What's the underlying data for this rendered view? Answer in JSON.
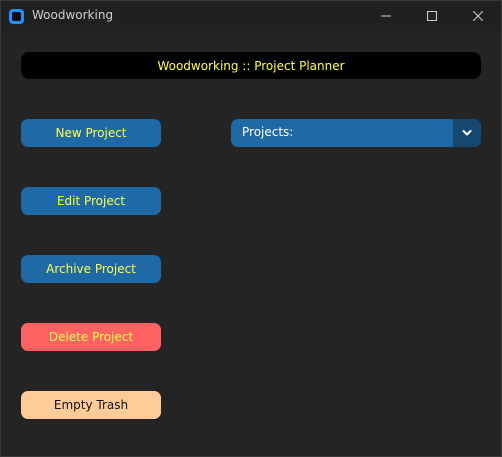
{
  "window": {
    "title": "Woodworking",
    "icon": "app-icon",
    "controls": [
      "minimize-icon",
      "maximize-icon",
      "close-icon"
    ]
  },
  "header": {
    "title": "Woodworking :: Project Planner"
  },
  "buttons": {
    "new_project": "New Project",
    "edit_project": "Edit Project",
    "archive_project": "Archive Project",
    "delete_project": "Delete Project",
    "empty_trash": "Empty Trash"
  },
  "projects_dropdown": {
    "selected": "Projects:",
    "icon": "chevron-down-icon"
  },
  "colors": {
    "background": "#242424",
    "accent_blue": "#1f6aa5",
    "dropdown_arrow_bg": "#144870",
    "label_yellow": "#ffff4f",
    "delete_red": "#ff6361",
    "trash_peach": "#ffcc99",
    "header_bg": "#000000"
  }
}
